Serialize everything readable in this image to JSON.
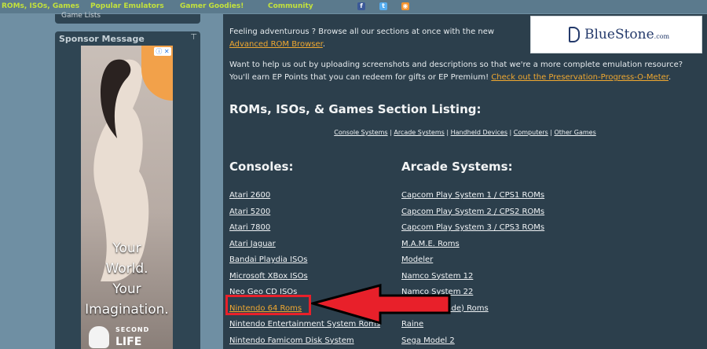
{
  "nav": {
    "items": [
      "ROMs, ISOs, Games",
      "Popular Emulators",
      "Gamer Goodies!",
      "Community"
    ],
    "social": [
      "facebook-icon",
      "twitter-icon",
      "rss-icon"
    ]
  },
  "sidebar": {
    "gamelist_label": "Game Lists",
    "sponsor_title": "Sponsor Message",
    "ad": {
      "line1": "Your",
      "line2": "World.",
      "line3": "Your",
      "line4": "Imagination.",
      "brand_top": "SECOND",
      "brand_bottom": "LIFE"
    }
  },
  "banner": {
    "brand": "BlueStone",
    "suffix": ".com"
  },
  "intro": {
    "p1_text": "Feeling adventurous ? Browse all our sections at once with the new ",
    "p1_link": "Advanced ROM Browser",
    "p2_text": "Want to help us out by uploading screenshots and descriptions so that we're a more complete emulation resource? You'll earn EP Points that you can redeem for gifts or EP Premium! ",
    "p2_link": "Check out the Preservation-Progress-O-Meter"
  },
  "section_title": "ROMs, ISOs, & Games Section Listing:",
  "quicklinks": [
    "Console Systems",
    "Arcade Systems",
    "Handheld Devices",
    "Computers",
    "Other Games"
  ],
  "consoles": {
    "heading": "Consoles:",
    "items": [
      "Atari 2600",
      "Atari 5200",
      "Atari 7800",
      "Atari Jaguar",
      "Bandai Playdia ISOs",
      "Microsoft XBox ISOs",
      "Neo Geo CD ISOs",
      "Nintendo 64 Roms",
      "Nintendo Entertainment System Roms",
      "Nintendo Famicom Disk System"
    ]
  },
  "arcade": {
    "heading": "Arcade Systems:",
    "items": [
      "Capcom Play System 1 / CPS1 ROMs",
      "Capcom Play System 2 / CPS2 ROMs",
      "Capcom Play System 3 / CPS3 ROMs",
      "M.A.M.E. Roms",
      "Modeler",
      "Namco System 12",
      "Namco System 22",
      "rcade) Roms",
      "Raine",
      "Sega Model 2"
    ]
  },
  "colors": {
    "link_accent": "#f0a830",
    "nav_text": "#c3e23c",
    "highlight": "#e8202a"
  }
}
